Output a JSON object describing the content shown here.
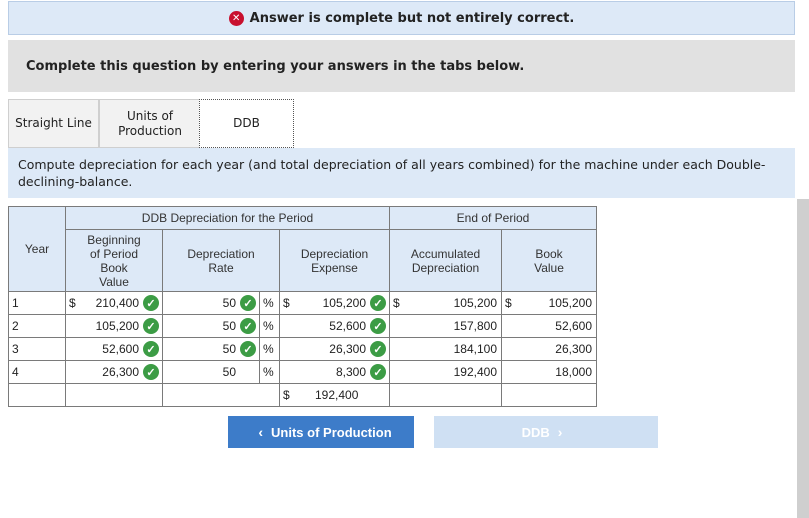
{
  "banner": {
    "icon": "x-circle-icon",
    "text": "Answer is complete but not entirely correct."
  },
  "instruction": "Complete this question by entering your answers in the tabs below.",
  "tabs": [
    {
      "label": "Straight Line"
    },
    {
      "label": "Units of\nProduction"
    },
    {
      "label": "DDB"
    }
  ],
  "prompt": "Compute depreciation for each year (and total depreciation of all years combined) for the machine under each Double-declining-balance.",
  "table": {
    "group_headers": {
      "period": "DDB Depreciation for the Period",
      "end": "End of Period"
    },
    "columns": {
      "year": "Year",
      "beginning": "Beginning\nof Period\nBook\nValue",
      "rate": "Depreciation\nRate",
      "expense": "Depreciation\nExpense",
      "accumulated": "Accumulated\nDepreciation",
      "book": "Book\nValue"
    },
    "currency": "$",
    "percent": "%",
    "rows": [
      {
        "year": "1",
        "beginning": "210,400",
        "rate": "50",
        "expense": "105,200",
        "accumulated": "105,200",
        "book": "105,200"
      },
      {
        "year": "2",
        "beginning": "105,200",
        "rate": "50",
        "expense": "52,600",
        "accumulated": "157,800",
        "book": "52,600"
      },
      {
        "year": "3",
        "beginning": "52,600",
        "rate": "50",
        "expense": "26,300",
        "accumulated": "184,100",
        "book": "26,300"
      },
      {
        "year": "4",
        "beginning": "26,300",
        "rate": "50",
        "expense": "8,300",
        "accumulated": "192,400",
        "book": "18,000"
      }
    ],
    "total_expense": "192,400"
  },
  "nav": {
    "prev_label": "Units of Production",
    "next_label": "DDB"
  },
  "colors": {
    "correct": "#3c9c45",
    "incorrect": "#c8102e",
    "accent": "#3d7cc9"
  }
}
